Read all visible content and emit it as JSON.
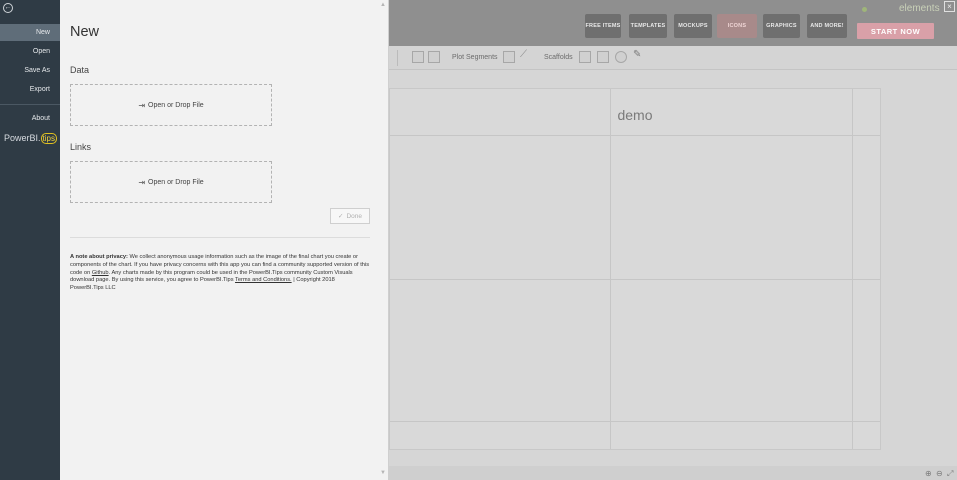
{
  "nav": {
    "back_icon": "back-arrow-icon",
    "items": [
      {
        "label": "New",
        "active": true
      },
      {
        "label": "Open",
        "active": false
      },
      {
        "label": "Save As",
        "active": false
      },
      {
        "label": "Export",
        "active": false
      },
      {
        "label": "About",
        "active": false
      }
    ],
    "logo": {
      "main": "PowerBI.",
      "tips": "tips"
    }
  },
  "drawer": {
    "title": "New",
    "data_section": {
      "label": "Data",
      "drop_label": "Open or Drop File"
    },
    "links_section": {
      "label": "Links",
      "drop_label": "Open or Drop File"
    },
    "done_label": "Done",
    "privacy": {
      "heading": "A note about privacy:",
      "text1": " We collect anonymous usage information such as the image of the final chart you create or components of the chart. If you have privacy concerns with this app you can find a community supported version of this code on ",
      "github_link": "Github",
      "text2": ". Any charts made by this program could be used in the PowerBI.Tips community Custom Visuals download page. By using this service, you agree to PowerBI.Tips ",
      "terms_link": "Terms and Conditions.",
      "text3": " | Copyright 2018 PowerBI.Tips LLC"
    }
  },
  "background": {
    "banner_buttons": [
      "FREE ITEMS",
      "TEMPLATES",
      "MOCKUPS",
      "ICONS",
      "GRAPHICS",
      "AND MORE!"
    ],
    "start_now": "START NOW",
    "elements_logo": "elements",
    "toolbar": {
      "plot_segments": "Plot Segments",
      "scaffolds": "Scaffolds"
    },
    "chart_title": "demo"
  },
  "colors": {
    "nav_bg": "#2f3b45",
    "nav_active": "#5f6d79",
    "drawer_bg": "#f2f2f2",
    "tips_accent": "#f2d23b",
    "start_now": "#d9a0a8"
  }
}
